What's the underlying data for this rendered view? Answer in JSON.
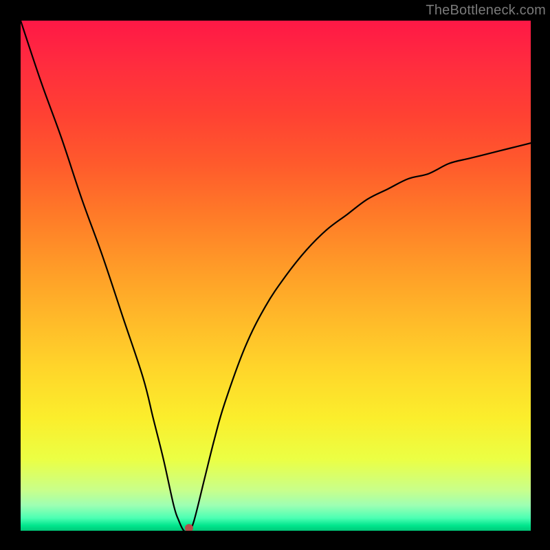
{
  "watermark": "TheBottleneck.com",
  "chart_data": {
    "type": "line",
    "title": "",
    "xlabel": "",
    "ylabel": "",
    "xlim": [
      0,
      100
    ],
    "ylim": [
      0,
      100
    ],
    "grid": false,
    "legend": false,
    "background_gradient": {
      "direction": "vertical",
      "stops": [
        {
          "pos": 0.0,
          "color": "#ff1846"
        },
        {
          "pos": 0.5,
          "color": "#ffb829"
        },
        {
          "pos": 0.8,
          "color": "#f5ff3a"
        },
        {
          "pos": 1.0,
          "color": "#00c878"
        }
      ]
    },
    "series": [
      {
        "name": "bottleneck-curve",
        "color": "#000000",
        "x": [
          0,
          4,
          8,
          12,
          16,
          20,
          24,
          26,
          28,
          30,
          31,
          32,
          33,
          34,
          36,
          38,
          40,
          44,
          48,
          52,
          56,
          60,
          64,
          68,
          72,
          76,
          80,
          84,
          88,
          92,
          96,
          100
        ],
        "values": [
          100,
          88,
          77,
          65,
          54,
          42,
          30,
          22,
          14,
          5,
          2,
          0,
          0,
          2,
          10,
          18,
          25,
          36,
          44,
          50,
          55,
          59,
          62,
          65,
          67,
          69,
          70,
          72,
          73,
          74,
          75,
          76
        ]
      }
    ],
    "marker": {
      "name": "optimal-point",
      "x": 33,
      "y": 0.5,
      "color": "#b54d49",
      "radius_px": 6
    }
  }
}
